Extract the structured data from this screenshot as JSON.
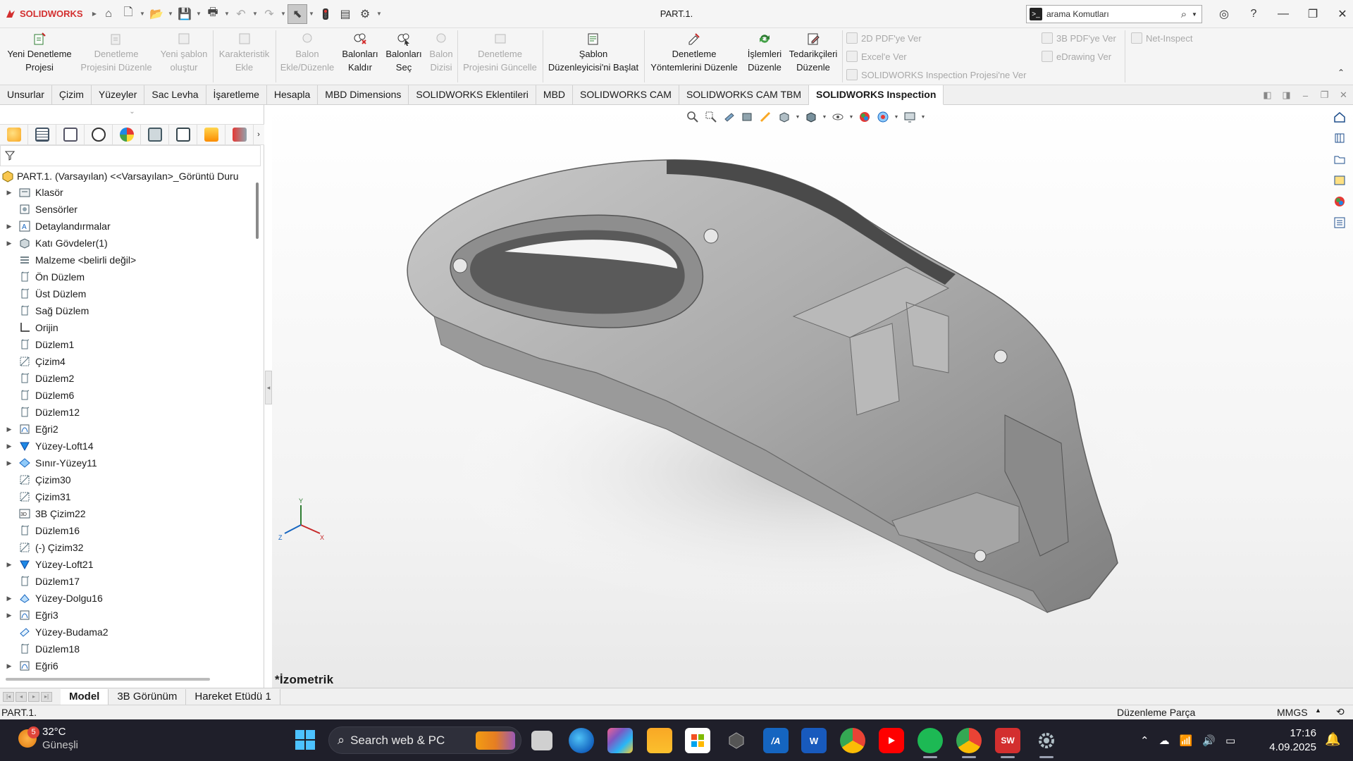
{
  "app": {
    "brand": "SOLIDWORKS",
    "document_title": "PART.1.",
    "search_placeholder": "arama Komutları"
  },
  "ribbon": {
    "buttons": [
      {
        "label1": "Yeni Denetleme",
        "label2": "Projesi",
        "enabled": true
      },
      {
        "label1": "Denetleme",
        "label2": "Projesini Düzenle",
        "enabled": false
      },
      {
        "label1": "Yeni şablon",
        "label2": "oluştur",
        "enabled": false
      },
      {
        "label1": "Karakteristik",
        "label2": "Ekle",
        "enabled": false
      },
      {
        "label1": "Balon",
        "label2": "Ekle/Düzenle",
        "enabled": false
      },
      {
        "label1": "Balonları",
        "label2": "Kaldır",
        "enabled": true
      },
      {
        "label1": "Balonları",
        "label2": "Seç",
        "enabled": true
      },
      {
        "label1": "Balon",
        "label2": "Dizisi",
        "enabled": false
      },
      {
        "label1": "Denetleme",
        "label2": "Projesini Güncelle",
        "enabled": false
      },
      {
        "label1": "Şablon",
        "label2": "Düzenleyicisi'ni Başlat",
        "enabled": true
      },
      {
        "label1": "Denetleme",
        "label2": "Yöntemlerini Düzenle",
        "enabled": true
      },
      {
        "label1": "İşlemleri",
        "label2": "Düzenle",
        "enabled": true
      },
      {
        "label1": "Tedarikçileri",
        "label2": "Düzenle",
        "enabled": true
      }
    ],
    "export_items": [
      "2D PDF'ye Ver",
      "Excel'e Ver",
      "SOLIDWORKS Inspection Projesi'ne Ver",
      "3B PDF'ye Ver",
      "eDrawing Ver",
      "Net-Inspect"
    ]
  },
  "command_tabs": [
    "Unsurlar",
    "Çizim",
    "Yüzeyler",
    "Sac Levha",
    "İşaretleme",
    "Hesapla",
    "MBD Dimensions",
    "SOLIDWORKS Eklentileri",
    "MBD",
    "SOLIDWORKS CAM",
    "SOLIDWORKS CAM TBM",
    "SOLIDWORKS Inspection"
  ],
  "active_tab": "SOLIDWORKS Inspection",
  "feature_tree": {
    "root": "PART.1. (Varsayılan) <<Varsayılan>_Görüntü Duru",
    "items": [
      {
        "label": "Klasör",
        "icon": "folder-icon",
        "expandable": true
      },
      {
        "label": "Sensörler",
        "icon": "sensor-icon",
        "expandable": false
      },
      {
        "label": "Detaylandırmalar",
        "icon": "annotation-icon",
        "expandable": true
      },
      {
        "label": "Katı Gövdeler(1)",
        "icon": "solid-body-icon",
        "expandable": true
      },
      {
        "label": "Malzeme <belirli değil>",
        "icon": "material-icon",
        "expandable": false
      },
      {
        "label": "Ön Düzlem",
        "icon": "plane-icon",
        "expandable": false
      },
      {
        "label": "Üst Düzlem",
        "icon": "plane-icon",
        "expandable": false
      },
      {
        "label": "Sağ Düzlem",
        "icon": "plane-icon",
        "expandable": false
      },
      {
        "label": "Orijin",
        "icon": "origin-icon",
        "expandable": false
      },
      {
        "label": "Düzlem1",
        "icon": "plane-icon",
        "expandable": false
      },
      {
        "label": "Çizim4",
        "icon": "sketch-icon",
        "expandable": false
      },
      {
        "label": "Düzlem2",
        "icon": "plane-icon",
        "expandable": false
      },
      {
        "label": "Düzlem6",
        "icon": "plane-icon",
        "expandable": false
      },
      {
        "label": "Düzlem12",
        "icon": "plane-icon",
        "expandable": false
      },
      {
        "label": "Eğri2",
        "icon": "curve-icon",
        "expandable": true
      },
      {
        "label": "Yüzey-Loft14",
        "icon": "loft-icon",
        "expandable": true
      },
      {
        "label": "Sınır-Yüzey11",
        "icon": "boundary-surface-icon",
        "expandable": true
      },
      {
        "label": "Çizim30",
        "icon": "sketch-icon",
        "expandable": false
      },
      {
        "label": "Çizim31",
        "icon": "sketch-icon",
        "expandable": false
      },
      {
        "label": "3B Çizim22",
        "icon": "sketch-3d-icon",
        "expandable": false
      },
      {
        "label": "Düzlem16",
        "icon": "plane-icon",
        "expandable": false
      },
      {
        "label": "(-) Çizim32",
        "icon": "sketch-icon",
        "expandable": false
      },
      {
        "label": "Yüzey-Loft21",
        "icon": "loft-icon",
        "expandable": true
      },
      {
        "label": "Düzlem17",
        "icon": "plane-icon",
        "expandable": false
      },
      {
        "label": "Yüzey-Dolgu16",
        "icon": "fill-surface-icon",
        "expandable": true
      },
      {
        "label": "Eğri3",
        "icon": "curve-icon",
        "expandable": true
      },
      {
        "label": "Yüzey-Budama2",
        "icon": "trim-surface-icon",
        "expandable": false
      },
      {
        "label": "Düzlem18",
        "icon": "plane-icon",
        "expandable": false
      },
      {
        "label": "Eğri6",
        "icon": "curve-icon",
        "expandable": true
      }
    ]
  },
  "viewport": {
    "view_name": "*İzometrik",
    "triad": {
      "x": "X",
      "y": "Y",
      "z": "Z"
    }
  },
  "bottom_tabs": [
    "Model",
    "3B Görünüm",
    "Hareket Etüdü 1"
  ],
  "active_bottom_tab": "Model",
  "status": {
    "left": "PART.1.",
    "mode": "Düzenleme Parça",
    "units": "MMGS"
  },
  "taskbar": {
    "weather_badge": "5",
    "temperature": "32°C",
    "condition": "Güneşli",
    "search_placeholder": "Search web & PC",
    "time": "17:16",
    "date": "4.09.2025"
  }
}
